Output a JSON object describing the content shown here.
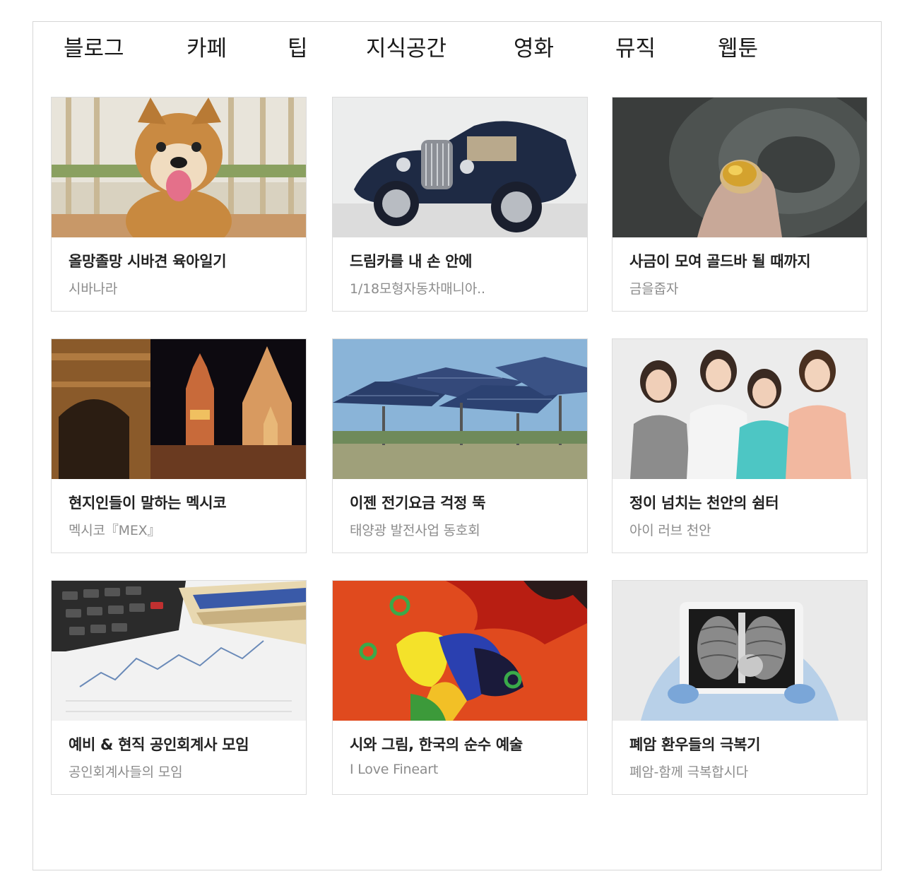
{
  "nav": {
    "items": [
      {
        "label": "블로그"
      },
      {
        "label": "카페"
      },
      {
        "label": "팁"
      },
      {
        "label": "지식공간"
      },
      {
        "label": "영화"
      },
      {
        "label": "뮤직"
      },
      {
        "label": "웹툰"
      }
    ]
  },
  "cards": [
    {
      "title": "올망졸망 시바견 육아일기",
      "subtitle": "시바나라",
      "image": "shiba-puppy-photo"
    },
    {
      "title": "드림카를 내 손 안에",
      "subtitle": "1/18모형자동차매니아..",
      "image": "model-car-photo"
    },
    {
      "title": "사금이 모여 골드바 될 때까지",
      "subtitle": "금을줍자",
      "image": "gold-nugget-photo"
    },
    {
      "title": "현지인들이 말하는 멕시코",
      "subtitle": "멕시코『MEX』",
      "image": "mexico-night-church-photo"
    },
    {
      "title": "이젠 전기요금 걱정 뚝",
      "subtitle": "태양광 발전사업 동호회",
      "image": "solar-panels-photo"
    },
    {
      "title": "정이 넘치는 천안의 쉼터",
      "subtitle": "아이 러브 천안",
      "image": "four-women-photo"
    },
    {
      "title": "예비 & 현직 공인회계사 모임",
      "subtitle": "공인회계사들의 모임",
      "image": "calculator-money-chart-photo"
    },
    {
      "title": "시와 그림, 한국의 순수 예술",
      "subtitle": "I Love Fineart",
      "image": "abstract-painting-photo"
    },
    {
      "title": "폐암 환우들의 극복기",
      "subtitle": "폐암-함께 극복합시다",
      "image": "chest-xray-photo"
    }
  ]
}
